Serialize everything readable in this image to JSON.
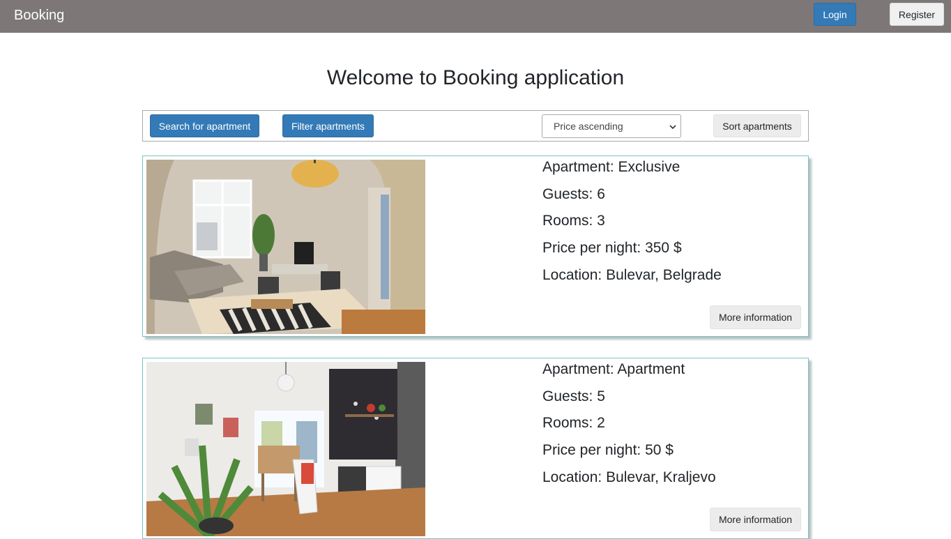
{
  "navbar": {
    "brand": "Booking",
    "login_label": "Login",
    "register_label": "Register"
  },
  "page": {
    "title": "Welcome to Booking application"
  },
  "toolbar": {
    "search_label": "Search for apartment",
    "filter_label": "Filter apartments",
    "sort_selected": "Price ascending",
    "sort_label": "Sort apartments"
  },
  "apartments": [
    {
      "name_line": "Apartment: Exclusive",
      "guests_line": "Guests: 6",
      "rooms_line": "Rooms: 3",
      "price_line": "Price per night: 350 $",
      "location_line": "Location: Bulevar, Belgrade",
      "more_label": "More information"
    },
    {
      "name_line": "Apartment: Apartment",
      "guests_line": "Guests: 5",
      "rooms_line": "Rooms: 2",
      "price_line": "Price per night: 50 $",
      "location_line": "Location: Bulevar, Kraljevo",
      "more_label": "More information"
    }
  ],
  "colors": {
    "navbar": "#7d7778",
    "primary": "#337ab7",
    "card_border": "#76c3c5"
  }
}
